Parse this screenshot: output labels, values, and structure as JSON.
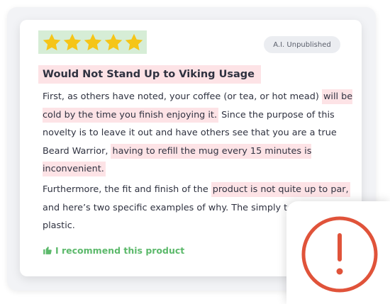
{
  "review": {
    "rating": 5,
    "rating_max": 5,
    "badge": "A.I. Unpublished",
    "title": "Would Not Stand Up to Viking Usage",
    "p1_a": "First, as others have noted, your coffee (or tea, or hot mead) ",
    "p1_b": "will be cold by the time you finish enjoying it.",
    "p1_c": " Since the purpose of this novelty is to leave it out and have others see that you are a true Beard Warrior, ",
    "p1_d": "having to refill the mug every 15 minutes is inconvenient.",
    "p2_a": "Furthermore, the fit and finish of the ",
    "p2_b": "product is not quite up to par,",
    "p2_c": " and here’s two specific examples of why. The simply textured white plastic.",
    "recommend": "I recommend this product"
  },
  "colors": {
    "star": "#f5c518",
    "highlight_red": "#fde3e6",
    "highlight_green": "#d6edd6",
    "recommend": "#5cb96b",
    "alert": "#e0533a"
  },
  "icons": {
    "star": "star-icon",
    "thumb": "thumbs-up-icon",
    "alert": "exclamation-circle-icon"
  }
}
